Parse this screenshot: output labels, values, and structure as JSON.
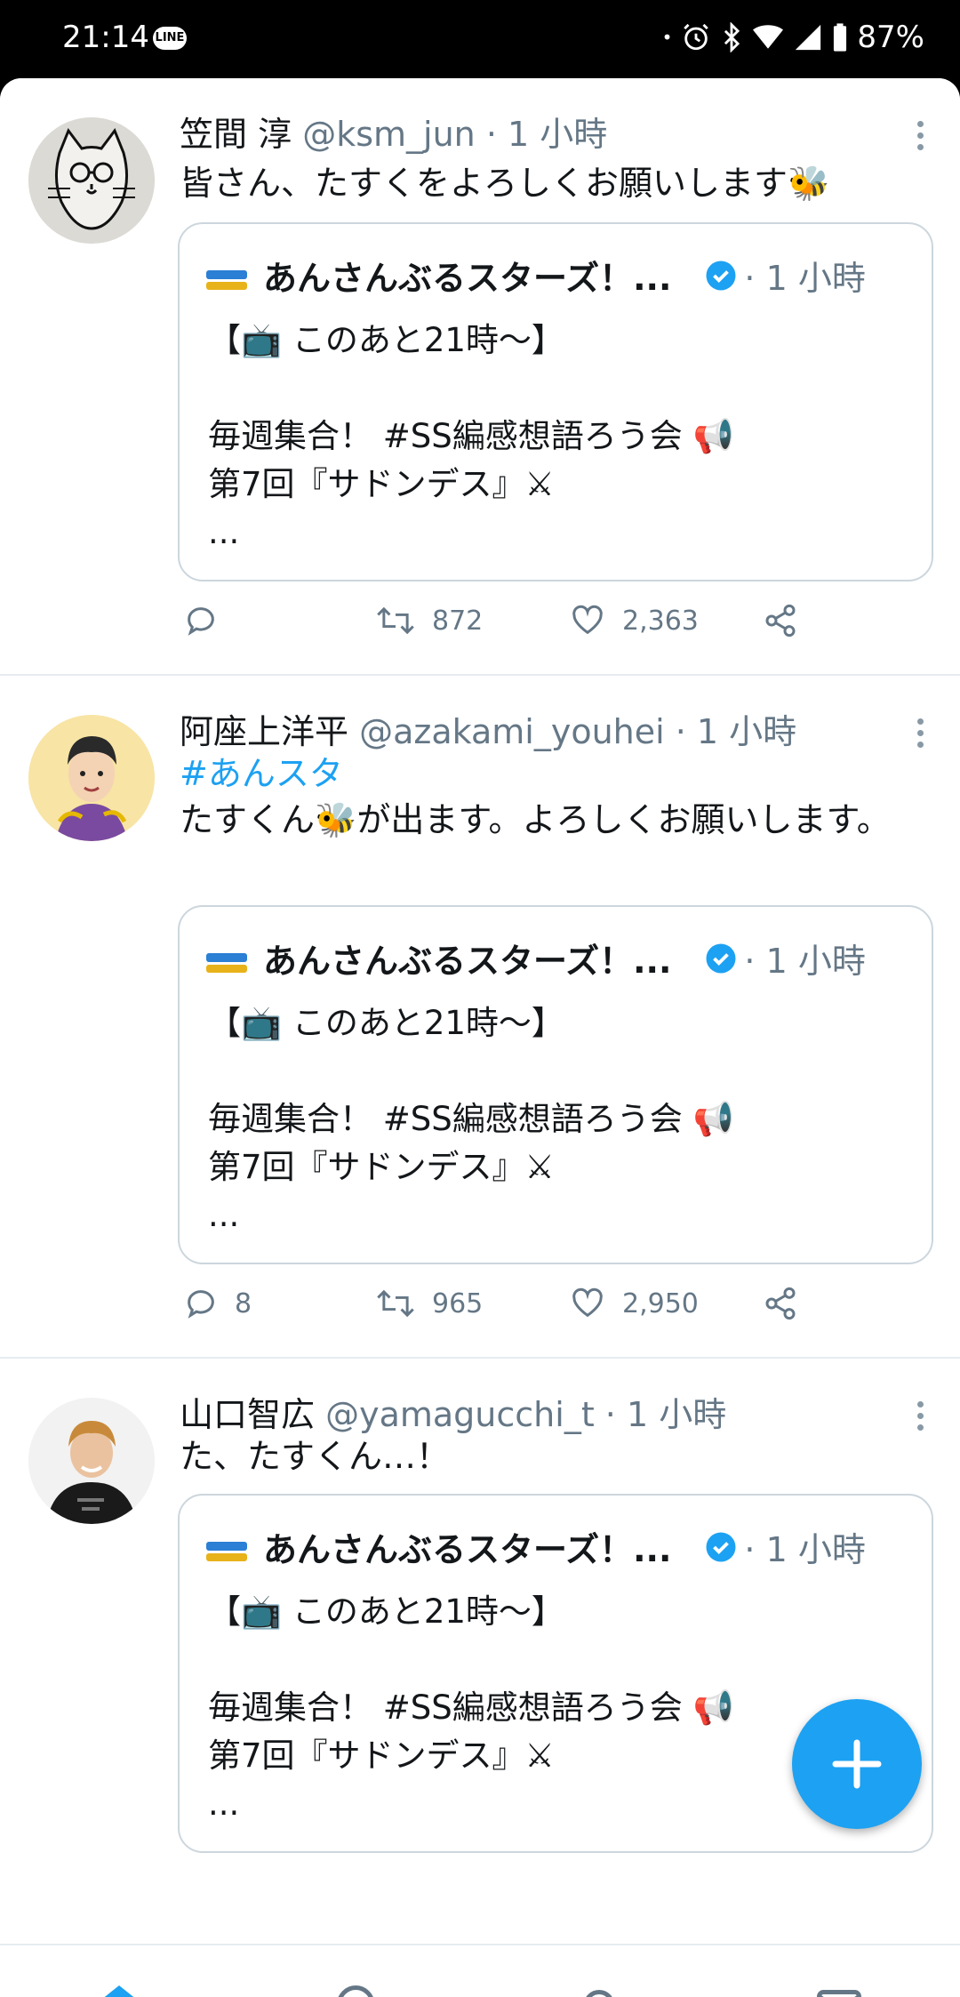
{
  "status_bar": {
    "time": "21:14",
    "line_badge": "LINE",
    "battery": "87%"
  },
  "quote_card": {
    "account_name": "あんさんぶるスターズ！...",
    "time": "· 1 小時",
    "body": "【📺 このあと21時〜】\n\n毎週集合！ #SS編感想語ろう会 📢\n第7回『サドンデス』⚔\n..."
  },
  "tweets": [
    {
      "name": "笠間 淳",
      "meta": "@ksm_jun · 1 小時",
      "text": "皆さん、たすくをよろしくお願いします🐝",
      "reply_count": "",
      "retweet_count": "872",
      "like_count": "2,363"
    },
    {
      "name": "阿座上洋平",
      "meta": "@azakami_youhei · 1 小時",
      "hashtag": "#あんスタ",
      "text": "たすくん🐝が出ます。よろしくお願いします。",
      "reply_count": "8",
      "retweet_count": "965",
      "like_count": "2,950"
    },
    {
      "name": "山口智広",
      "meta": "@yamagucchi_t · 1 小時",
      "text": "た、たすくん…！"
    }
  ],
  "colors": {
    "accent": "#1da1f2",
    "secondary_text": "#657786",
    "border": "#ccd6dd"
  },
  "icons": {
    "reply": "comment-bubble-icon",
    "retweet": "retweet-icon",
    "like": "heart-icon",
    "share": "share-icon",
    "compose": "plus-icon",
    "nav": [
      "home-icon",
      "search-icon",
      "bell-icon",
      "mail-icon"
    ]
  }
}
